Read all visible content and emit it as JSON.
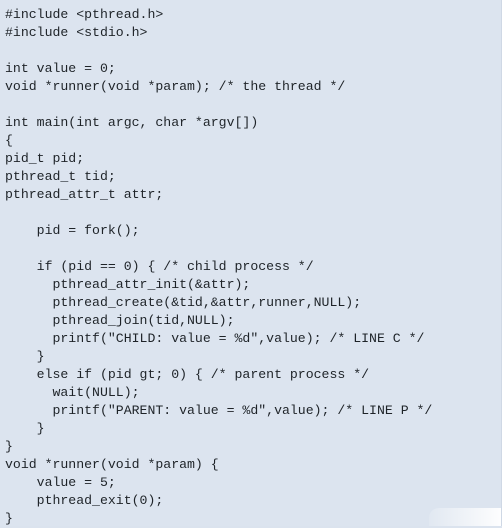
{
  "code_lines": [
    "#include <pthread.h>",
    "#include <stdio.h>",
    "",
    "int value = 0;",
    "void *runner(void *param); /* the thread */",
    "",
    "int main(int argc, char *argv[])",
    "{",
    "pid_t pid;",
    "pthread_t tid;",
    "pthread_attr_t attr;",
    "",
    "    pid = fork();",
    "",
    "    if (pid == 0) { /* child process */",
    "      pthread_attr_init(&attr);",
    "      pthread_create(&tid,&attr,runner,NULL);",
    "      pthread_join(tid,NULL);",
    "      printf(\"CHILD: value = %d\",value); /* LINE C */",
    "    }",
    "    else if (pid gt; 0) { /* parent process */",
    "      wait(NULL);",
    "      printf(\"PARENT: value = %d\",value); /* LINE P */",
    "    }",
    "}",
    "void *runner(void *param) {",
    "    value = 5;",
    "    pthread_exit(0);",
    "}"
  ]
}
